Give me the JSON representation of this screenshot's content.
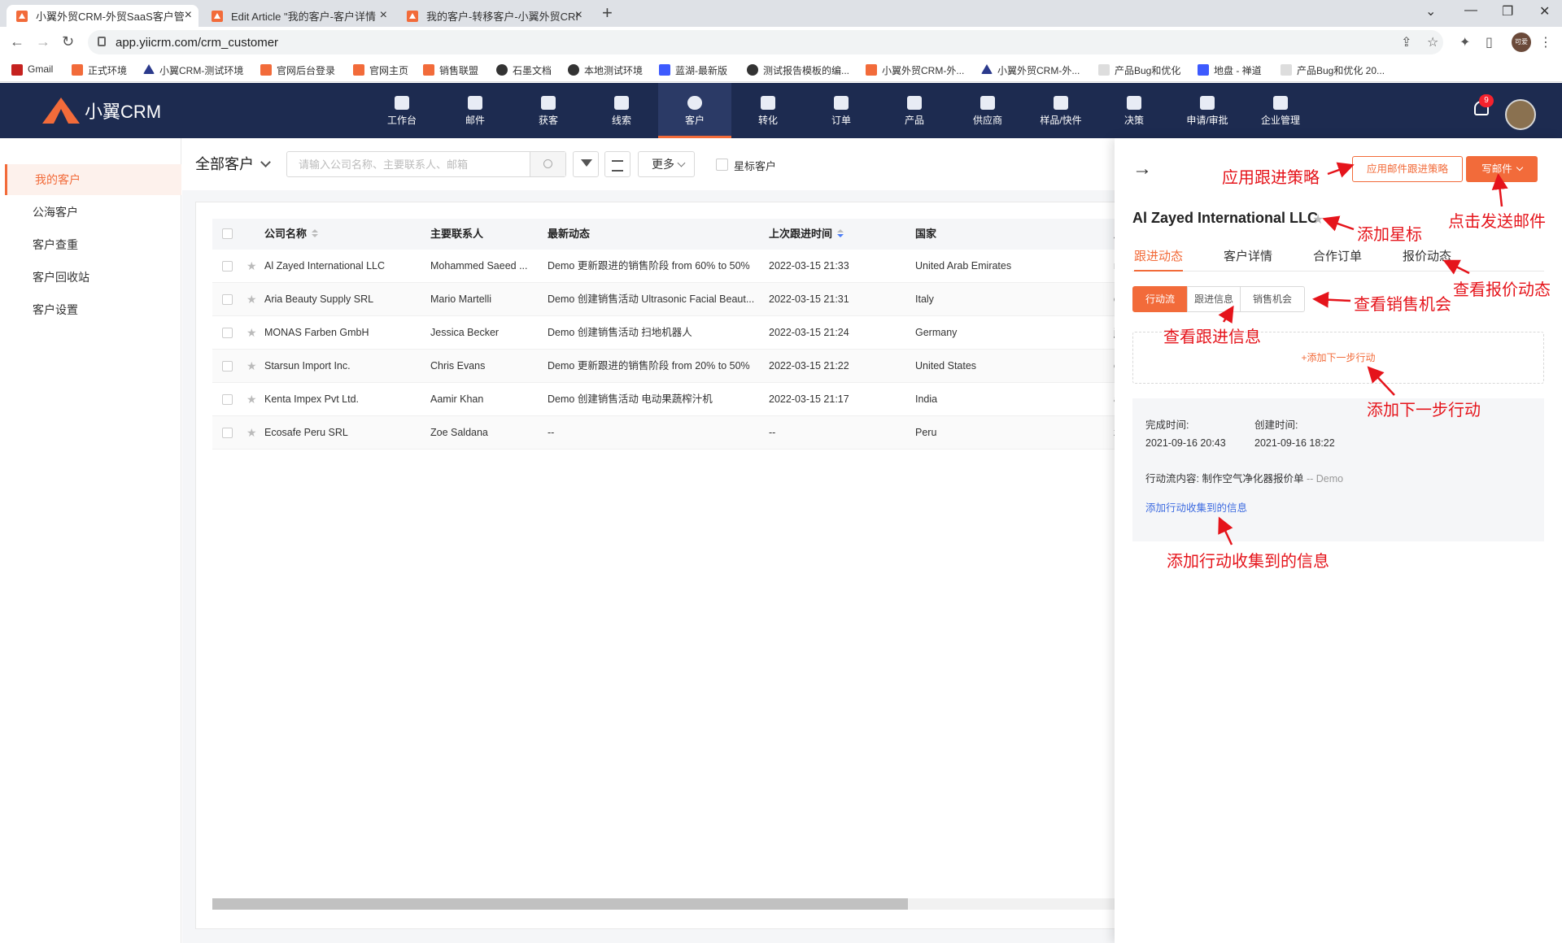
{
  "browser": {
    "tabs": [
      {
        "title": "小翼外贸CRM-外贸SaaS客户管"
      },
      {
        "title": "Edit Article \"我的客户-客户详情"
      },
      {
        "title": "我的客户-转移客户-小翼外贸CRI"
      }
    ],
    "url": "app.yiicrm.com/crm_customer",
    "profile_label": "可爱",
    "bookmarks": [
      "Gmail",
      "正式环境",
      "小翼CRM-测试环境",
      "官网后台登录",
      "官网主页",
      "销售联盟",
      "石墨文档",
      "本地测试环境",
      "蓝湖-最新版",
      "测试报告模板的编...",
      "小翼外贸CRM-外...",
      "小翼外贸CRM-外...",
      "产品Bug和优化",
      "地盘 - 禅道",
      "产品Bug和优化 20..."
    ]
  },
  "app": {
    "logo_text": "小翼CRM",
    "nav": [
      "工作台",
      "邮件",
      "获客",
      "线索",
      "客户",
      "转化",
      "订单",
      "产品",
      "供应商",
      "样品/快件",
      "决策",
      "申请/审批",
      "企业管理"
    ],
    "active_nav": "客户",
    "notification_count": "9"
  },
  "sidebar": {
    "items": [
      "我的客户",
      "公海客户",
      "客户查重",
      "客户回收站",
      "客户设置"
    ],
    "active": "我的客户"
  },
  "toolbar": {
    "view_label": "全部客户",
    "search_placeholder": "请输入公司名称、主要联系人、邮箱",
    "more_label": "更多",
    "star_filter_label": "星标客户"
  },
  "table": {
    "columns": [
      "公司名称",
      "主要联系人",
      "最新动态",
      "上次跟进时间",
      "国家",
      "主要"
    ],
    "rows": [
      {
        "company": "Al Zayed International LLC",
        "contact": "Mohammed Saeed ...",
        "activity": "Demo 更新跟进的销售阶段 from 60% to 50%",
        "last": "2022-03-15 21:33",
        "country": "United Arab Emirates",
        "email": "moh"
      },
      {
        "company": "Aria Beauty Supply SRL",
        "contact": "Mario Martelli",
        "activity": "Demo 创建销售活动 Ultrasonic Facial Beaut...",
        "last": "2022-03-15 21:31",
        "country": "Italy",
        "email": "dire"
      },
      {
        "company": "MONAS Farben GmbH",
        "contact": "Jessica Becker",
        "activity": "Demo 创建销售活动 扫地机器人",
        "last": "2022-03-15 21:24",
        "country": "Germany",
        "email": "jess"
      },
      {
        "company": "Starsun Import Inc.",
        "contact": "Chris Evans",
        "activity": "Demo 更新跟进的销售阶段 from 20% to 50%",
        "last": "2022-03-15 21:22",
        "country": "United States",
        "email": "chri"
      },
      {
        "company": "Kenta Impex Pvt Ltd.",
        "contact": "Aamir Khan",
        "activity": "Demo 创建销售活动 电动果蔬榨汁机",
        "last": "2022-03-15 21:17",
        "country": "India",
        "email": "aam"
      },
      {
        "company": "Ecosafe Peru SRL",
        "contact": "Zoe Saldana",
        "activity": "--",
        "last": "--",
        "country": "Peru",
        "email": "zoe."
      }
    ]
  },
  "drawer": {
    "apply_strategy_label": "应用邮件跟进策略",
    "write_mail_label": "写邮件",
    "customer_name": "Al Zayed International LLC",
    "tabs": [
      "跟进动态",
      "客户详情",
      "合作订单",
      "报价动态"
    ],
    "active_tab": "跟进动态",
    "segments": [
      "行动流",
      "跟进信息",
      "销售机会"
    ],
    "active_segment": "行动流",
    "add_next_label": "+添加下一步行动",
    "action": {
      "complete_label": "完成时间:",
      "complete_value": "2021-09-16 20:43",
      "created_label": "创建时间:",
      "created_value": "2021-09-16 18:22",
      "content_label": "行动流内容:",
      "content_value": "制作空气净化器报价单",
      "content_suffix": "-- Demo",
      "collect_link": "添加行动收集到的信息"
    }
  },
  "annotations": [
    "应用跟进策略",
    "添加星标",
    "点击发送邮件",
    "查看报价动态",
    "查看销售机会",
    "查看跟进信息",
    "添加下一步行动",
    "添加行动收集到的信息"
  ],
  "colors": {
    "accent": "#f26b3a",
    "header": "#1d2b50",
    "annotation": "#e5141b",
    "link": "#3d6be0"
  }
}
